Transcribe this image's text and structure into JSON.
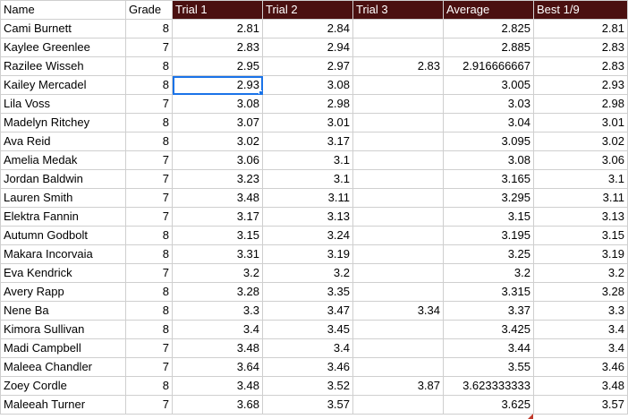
{
  "headers": {
    "name": "Name",
    "grade": "Grade",
    "trial1": "Trial 1",
    "trial2": "Trial 2",
    "trial3": "Trial 3",
    "average": "Average",
    "best": "Best 1/9"
  },
  "colors": {
    "header_dark": "#4a1010",
    "selection": "#1a73e8",
    "gridline": "#cfcfcf"
  },
  "selected_cell": {
    "row": 3,
    "column": "trial1"
  },
  "rows": [
    {
      "name": "Cami Burnett",
      "grade": "8",
      "trial1": "2.81",
      "trial2": "2.84",
      "trial3": "",
      "average": "2.825",
      "best": "2.81"
    },
    {
      "name": "Kaylee Greenlee",
      "grade": "7",
      "trial1": "2.83",
      "trial2": "2.94",
      "trial3": "",
      "average": "2.885",
      "best": "2.83"
    },
    {
      "name": "Razilee Wisseh",
      "grade": "8",
      "trial1": "2.95",
      "trial2": "2.97",
      "trial3": "2.83",
      "average": "2.916666667",
      "best": "2.83"
    },
    {
      "name": "Kailey Mercadel",
      "grade": "8",
      "trial1": "2.93",
      "trial2": "3.08",
      "trial3": "",
      "average": "3.005",
      "best": "2.93"
    },
    {
      "name": "Lila Voss",
      "grade": "7",
      "trial1": "3.08",
      "trial2": "2.98",
      "trial3": "",
      "average": "3.03",
      "best": "2.98"
    },
    {
      "name": "Madelyn Ritchey",
      "grade": "8",
      "trial1": "3.07",
      "trial2": "3.01",
      "trial3": "",
      "average": "3.04",
      "best": "3.01"
    },
    {
      "name": "Ava Reid",
      "grade": "8",
      "trial1": "3.02",
      "trial2": "3.17",
      "trial3": "",
      "average": "3.095",
      "best": "3.02"
    },
    {
      "name": "Amelia Medak",
      "grade": "7",
      "trial1": "3.06",
      "trial2": "3.1",
      "trial3": "",
      "average": "3.08",
      "best": "3.06"
    },
    {
      "name": "Jordan Baldwin",
      "grade": "7",
      "trial1": "3.23",
      "trial2": "3.1",
      "trial3": "",
      "average": "3.165",
      "best": "3.1"
    },
    {
      "name": "Lauren Smith",
      "grade": "7",
      "trial1": "3.48",
      "trial2": "3.11",
      "trial3": "",
      "average": "3.295",
      "best": "3.11"
    },
    {
      "name": "Elektra Fannin",
      "grade": "7",
      "trial1": "3.17",
      "trial2": "3.13",
      "trial3": "",
      "average": "3.15",
      "best": "3.13"
    },
    {
      "name": "Autumn Godbolt",
      "grade": "8",
      "trial1": "3.15",
      "trial2": "3.24",
      "trial3": "",
      "average": "3.195",
      "best": "3.15"
    },
    {
      "name": "Makara Incorvaia",
      "grade": "8",
      "trial1": "3.31",
      "trial2": "3.19",
      "trial3": "",
      "average": "3.25",
      "best": "3.19"
    },
    {
      "name": "Eva Kendrick",
      "grade": "7",
      "trial1": "3.2",
      "trial2": "3.2",
      "trial3": "",
      "average": "3.2",
      "best": "3.2"
    },
    {
      "name": "Avery Rapp",
      "grade": "8",
      "trial1": "3.28",
      "trial2": "3.35",
      "trial3": "",
      "average": "3.315",
      "best": "3.28"
    },
    {
      "name": "Nene Ba",
      "grade": "8",
      "trial1": "3.3",
      "trial2": "3.47",
      "trial3": "3.34",
      "average": "3.37",
      "best": "3.3"
    },
    {
      "name": "Kimora Sullivan",
      "grade": "8",
      "trial1": "3.4",
      "trial2": "3.45",
      "trial3": "",
      "average": "3.425",
      "best": "3.4"
    },
    {
      "name": "Madi Campbell",
      "grade": "7",
      "trial1": "3.48",
      "trial2": "3.4",
      "trial3": "",
      "average": "3.44",
      "best": "3.4"
    },
    {
      "name": "Maleea Chandler",
      "grade": "7",
      "trial1": "3.64",
      "trial2": "3.46",
      "trial3": "",
      "average": "3.55",
      "best": "3.46"
    },
    {
      "name": "Zoey Cordle",
      "grade": "8",
      "trial1": "3.48",
      "trial2": "3.52",
      "trial3": "3.87",
      "average": "3.623333333",
      "best": "3.48"
    },
    {
      "name": "Maleeah Turner",
      "grade": "7",
      "trial1": "3.68",
      "trial2": "3.57",
      "trial3": "",
      "average": "3.625",
      "best": "3.57"
    }
  ]
}
